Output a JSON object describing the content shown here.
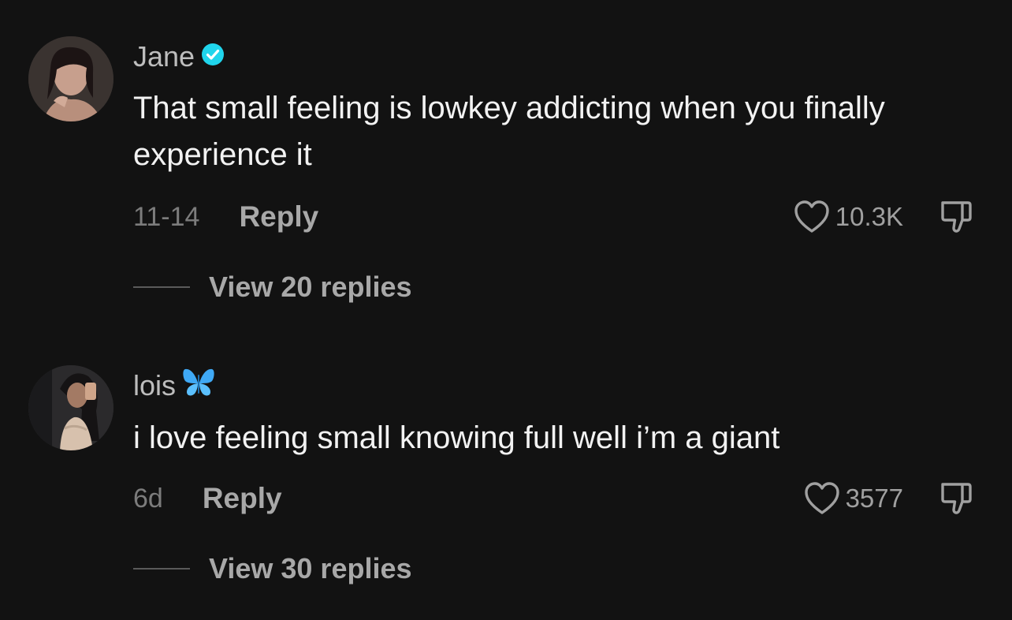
{
  "comments": [
    {
      "username": "Jane",
      "badge": "verified-icon",
      "text": "That small feeling is lowkey addicting when you finally experience it",
      "date": "11-14",
      "reply_label": "Reply",
      "likes": "10.3K",
      "view_replies": "View 20 replies"
    },
    {
      "username": "lois",
      "badge": "butterfly-icon",
      "text": "i love feeling small knowing full well i’m a giant",
      "date": "6d",
      "reply_label": "Reply",
      "likes": "3577",
      "view_replies": "View 30 replies"
    }
  ],
  "colors": {
    "background": "#121212",
    "verified": "#20D5EC",
    "butterfly": "#3FA9F5"
  }
}
